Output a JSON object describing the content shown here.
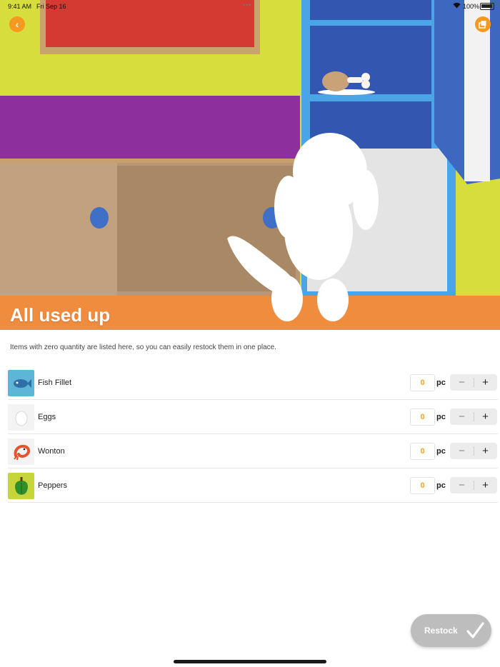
{
  "status_bar": {
    "time": "9:41 AM",
    "date": "Fri Sep 16",
    "battery": "100%"
  },
  "header": {
    "title": "All used up"
  },
  "description": "Items with zero quantity are listed here, so you can easily restock them in one place.",
  "items": [
    {
      "name": "Fish Fillet",
      "quantity": "0",
      "unit": "pc",
      "icon": "fish-icon"
    },
    {
      "name": "Eggs",
      "quantity": "0",
      "unit": "pc",
      "icon": "egg-icon"
    },
    {
      "name": "Wonton",
      "quantity": "0",
      "unit": "pc",
      "icon": "shrimp-icon"
    },
    {
      "name": "Peppers",
      "quantity": "0",
      "unit": "pc",
      "icon": "pepper-icon"
    }
  ],
  "stepper": {
    "minus": "−",
    "plus": "+"
  },
  "restock_button": {
    "label": "Restock"
  },
  "colors": {
    "accent": "#f59a1e",
    "quantity": "#f5a623",
    "restock_bg": "#bdbdbd"
  }
}
